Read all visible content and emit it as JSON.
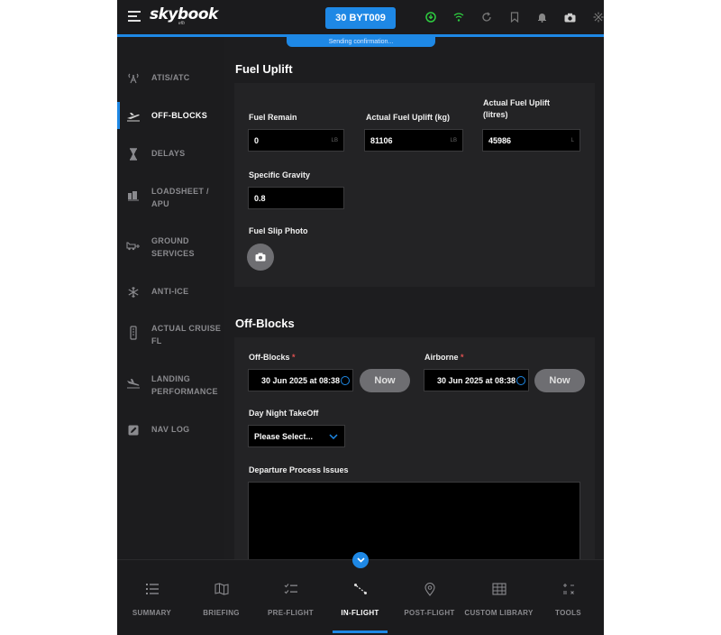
{
  "header": {
    "logo": "skybook",
    "logo_sub": "efb",
    "flight_number": "30 BYT009",
    "status": "Sending confirmation...",
    "icons": [
      "sync-status-icon",
      "wifi-icon",
      "refresh-icon",
      "bookmark-icon",
      "notification-icon",
      "camera-icon",
      "settings-icon"
    ]
  },
  "sidebar": {
    "items": [
      {
        "label": "ATIS/ATC",
        "icon": "radio-tower-icon"
      },
      {
        "label": "OFF-BLOCKS",
        "icon": "plane-departure-icon"
      },
      {
        "label": "DELAYS",
        "icon": "hourglass-icon"
      },
      {
        "label": "LOADSHEET / APU",
        "icon": "luggage-icon"
      },
      {
        "label": "GROUND SERVICES",
        "icon": "fuel-truck-icon"
      },
      {
        "label": "ANTI-ICE",
        "icon": "snowflake-icon"
      },
      {
        "label": "ACTUAL CRUISE FL",
        "icon": "altitude-icon"
      },
      {
        "label": "LANDING PERFORMANCE",
        "icon": "plane-landing-icon"
      },
      {
        "label": "NAV LOG",
        "icon": "edit-icon"
      }
    ],
    "active_index": 1
  },
  "fuel_uplift": {
    "title": "Fuel Uplift",
    "fuel_remain": {
      "label": "Fuel Remain",
      "value": "0",
      "unit": "LB"
    },
    "actual_uplift_kg": {
      "label": "Actual Fuel Uplift (kg)",
      "value": "81106",
      "unit": "LB"
    },
    "actual_uplift_litres": {
      "label": "Actual Fuel Uplift (litres)",
      "value": "45986",
      "unit": "L"
    },
    "specific_gravity": {
      "label": "Specific Gravity",
      "value": "0.8"
    },
    "fuel_slip_photo": {
      "label": "Fuel Slip Photo"
    }
  },
  "off_blocks": {
    "title": "Off-Blocks",
    "off_blocks_field": {
      "label": "Off-Blocks",
      "required": "*",
      "value": "30 Jun 2025 at 08:38"
    },
    "airborne_field": {
      "label": "Airborne",
      "required": "*",
      "value": "30 Jun 2025 at 08:38"
    },
    "now_label": "Now",
    "day_night": {
      "label": "Day Night TakeOff",
      "value": "Please Select..."
    },
    "departure_issues": {
      "label": "Departure Process Issues",
      "value": ""
    }
  },
  "bottom_nav": {
    "items": [
      {
        "label": "SUMMARY",
        "icon": "list-icon"
      },
      {
        "label": "BRIEFING",
        "icon": "map-icon"
      },
      {
        "label": "PRE-FLIGHT",
        "icon": "checklist-icon"
      },
      {
        "label": "IN-FLIGHT",
        "icon": "route-icon"
      },
      {
        "label": "POST-FLIGHT",
        "icon": "location-pin-icon"
      },
      {
        "label": "CUSTOM LIBRARY",
        "icon": "library-icon"
      },
      {
        "label": "TOOLS",
        "icon": "calculator-icon"
      }
    ],
    "active_index": 3
  },
  "colors": {
    "accent": "#1e88e5",
    "background": "#1d1d1f",
    "card": "#232325",
    "input": "#000000",
    "required": "#e05050",
    "success": "#2ecc40"
  }
}
